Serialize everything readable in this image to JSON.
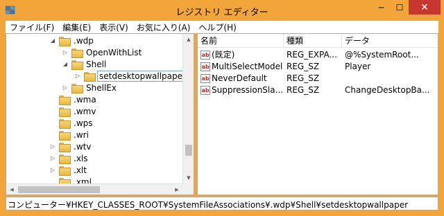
{
  "window": {
    "title": "レジストリ エディター",
    "accent_color": "#f2a63a",
    "close_color": "#c7372f",
    "controls": {
      "minimize": "─",
      "maximize": "☐",
      "close": "✕"
    }
  },
  "menu": {
    "items": [
      {
        "label": "ファイル(F)"
      },
      {
        "label": "編集(E)"
      },
      {
        "label": "表示(V)"
      },
      {
        "label": "お気に入り(A)"
      },
      {
        "label": "ヘルプ(H)"
      }
    ]
  },
  "tree": {
    "items": [
      {
        "label": ".wdp",
        "expander": "◢",
        "icon": "folder-icon"
      },
      {
        "label": "OpenWithList",
        "expander": "▷",
        "icon": "folder-icon"
      },
      {
        "label": "Shell",
        "expander": "◢",
        "icon": "folder-icon"
      },
      {
        "label": "setdesktopwallpaper",
        "expander": "▷",
        "icon": "folder-icon",
        "selected": true
      },
      {
        "label": "ShellEx",
        "expander": "▷",
        "icon": "folder-icon"
      },
      {
        "label": ".wma",
        "expander": "",
        "icon": "folder-icon"
      },
      {
        "label": ".wmv",
        "expander": "",
        "icon": "folder-icon"
      },
      {
        "label": ".wps",
        "expander": "",
        "icon": "folder-icon"
      },
      {
        "label": ".wri",
        "expander": "",
        "icon": "folder-icon"
      },
      {
        "label": ".wtv",
        "expander": "▷",
        "icon": "folder-icon"
      },
      {
        "label": ".xls",
        "expander": "▷",
        "icon": "folder-icon"
      },
      {
        "label": ".xlt",
        "expander": "▷",
        "icon": "folder-icon"
      },
      {
        "label": ".xml",
        "expander": "",
        "icon": "folder-icon"
      }
    ]
  },
  "list": {
    "headers": {
      "name": "名前",
      "type": "種類",
      "data": "データ"
    },
    "rows": [
      {
        "name": "(既定)",
        "type": "REG_EXPA...",
        "data": "@%SystemRoot..."
      },
      {
        "name": "MultiSelectModel",
        "type": "REG_SZ",
        "data": "Player"
      },
      {
        "name": "NeverDefault",
        "type": "REG_SZ",
        "data": ""
      },
      {
        "name": "SuppressionSla...",
        "type": "REG_SZ",
        "data": "ChangeDesktopBa..."
      }
    ],
    "value_icon_text": "ab"
  },
  "status": {
    "path": "コンピューター¥HKEY_CLASSES_ROOT¥SystemFileAssociations¥.wdp¥Shell¥setdesktopwallpaper"
  }
}
